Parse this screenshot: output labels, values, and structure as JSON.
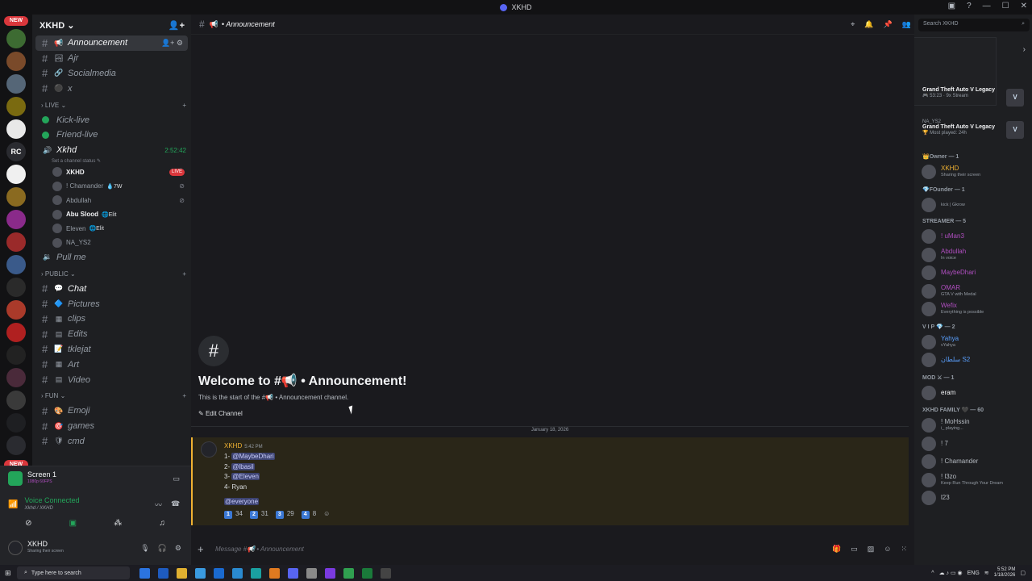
{
  "window": {
    "title": "XKHD"
  },
  "server": {
    "name": "XKHD"
  },
  "guilds": {
    "new_top": "NEW",
    "new_bottom": "NEW",
    "icons": [
      {
        "badge": "",
        "label": "",
        "color": "#3d6b32"
      },
      {
        "badge": "44",
        "label": "",
        "color": "#7a4a2a"
      },
      {
        "badge": "559",
        "label": "",
        "color": "#556677"
      },
      {
        "badge": "74",
        "label": "",
        "color": "#7a6a10"
      },
      {
        "badge": "",
        "label": "",
        "color": "#e8e8e8"
      },
      {
        "badge": "",
        "label": "RC",
        "color": "#2a2b30"
      },
      {
        "badge": "193",
        "label": "",
        "color": "#f0f0f0"
      },
      {
        "badge": "",
        "label": "",
        "color": "#8a6a20"
      },
      {
        "badge": "4K+",
        "label": "",
        "color": "#8a2a8a"
      },
      {
        "badge": "75",
        "label": "",
        "color": "#9a2a2a"
      },
      {
        "badge": "71",
        "label": "",
        "color": "#3a5a8a"
      },
      {
        "badge": "708",
        "label": "",
        "color": "#2a2a2a"
      },
      {
        "badge": "2K+",
        "label": "",
        "color": "#aa3a2a"
      },
      {
        "badge": "",
        "label": "",
        "color": "#b02020"
      },
      {
        "badge": "",
        "label": "",
        "color": "#222222"
      },
      {
        "badge": "",
        "label": "",
        "color": "#4a2a3a"
      },
      {
        "badge": "",
        "label": "",
        "color": "#3a3a3a"
      },
      {
        "badge": "",
        "label": "",
        "color": "#1e1f22"
      },
      {
        "badge": "",
        "label": "",
        "color": "#2a2b30"
      }
    ]
  },
  "channels": {
    "top": [
      {
        "name": "Announcement",
        "emoji": "📢",
        "active": true
      },
      {
        "name": "Ajr",
        "emoji": "🏞"
      },
      {
        "name": "Socialmedia",
        "emoji": "🔗"
      },
      {
        "name": "x",
        "emoji": "⚫"
      }
    ],
    "live_category": "LIVE",
    "live": [
      {
        "name": "Kick-live"
      },
      {
        "name": "Friend-live"
      }
    ],
    "voice_channel": {
      "name": "Xkhd",
      "timer": "2:52:42",
      "status": "Set a channel status"
    },
    "voice_users": [
      {
        "name": "XKHD",
        "tag": "",
        "live": "LIVE",
        "bold": true
      },
      {
        "name": "! Chamander",
        "tag": "💧7W"
      },
      {
        "name": "Abdullah",
        "tag": ""
      },
      {
        "name": "Abu Slood",
        "tag": "🌐Elit",
        "bold": true
      },
      {
        "name": "Eleven",
        "tag": "🌐Elit"
      },
      {
        "name": "NA_YS2",
        "tag": ""
      }
    ],
    "pull_me": "Pull me",
    "public_category": "PUBLIC",
    "public": [
      {
        "name": "Chat",
        "emoji": "💬",
        "bright": true
      },
      {
        "name": "Pictures",
        "emoji": "🔷"
      },
      {
        "name": "clips",
        "emoji": "▦"
      },
      {
        "name": "Edits",
        "emoji": "▤"
      },
      {
        "name": "tklejat",
        "emoji": "📝"
      },
      {
        "name": "Art",
        "emoji": "▦"
      },
      {
        "name": "Video",
        "emoji": "▤"
      }
    ],
    "fun_category": "FUN",
    "fun": [
      {
        "name": "Emoji",
        "emoji": "🎨"
      },
      {
        "name": "games",
        "emoji": "🎯"
      },
      {
        "name": "cmd",
        "emoji": "🛡"
      }
    ]
  },
  "panel": {
    "screen_title": "Screen 1",
    "screen_sub": "1080p 60FPS",
    "voice_connected": "Voice Connected",
    "voice_path": "Xkhd / XKHD",
    "user_name": "XKHD",
    "user_status": "Sharing their screen"
  },
  "chat": {
    "channel_title": "• Announcement",
    "welcome_title": "Welcome to #📢 • Announcement!",
    "welcome_sub": "This is the start of the #📢 • Announcement channel.",
    "edit_channel": "Edit Channel",
    "date": "January 18, 2026",
    "message": {
      "author": "XKHD",
      "time": "5:42 PM",
      "line1_prefix": "1-",
      "line1_mention": "@MaybeDhari",
      "line2_prefix": "2-",
      "line2_mention": "@lbasil",
      "line3_prefix": "3-",
      "line3_mention": "@Eleven",
      "line4": "4- Ryan",
      "everyone": "@everyone",
      "reactions": [
        {
          "key": "1",
          "count": "34"
        },
        {
          "key": "2",
          "count": "31"
        },
        {
          "key": "3",
          "count": "29"
        },
        {
          "key": "4",
          "count": "8"
        }
      ]
    },
    "input_placeholder": "Message #📢 • Announcement"
  },
  "members": {
    "search_placeholder": "Search XKHD",
    "games": [
      {
        "title": "Grand Theft Auto V Legacy",
        "sub": "🎮 53:23 · 9x Stream",
        "user": ""
      },
      {
        "title": "Grand Theft Auto V Legacy",
        "sub": "🏆 Most played: 24h",
        "user": "NA_YS2"
      }
    ],
    "groups": [
      {
        "title": "👑Owner — 1",
        "members": [
          {
            "name": "XKHD",
            "status": "Sharing their screen",
            "color": "#f0b232"
          }
        ]
      },
      {
        "title": "💎FOunder — 1",
        "members": [
          {
            "name": "",
            "status": "kick | Gkrow",
            "color": "#dbdee1"
          }
        ]
      },
      {
        "title": "STREAMER — 5",
        "members": [
          {
            "name": "! uMan3",
            "status": "",
            "color": "#b04ec0"
          },
          {
            "name": "Abdullah",
            "status": "In voice",
            "color": "#b04ec0"
          },
          {
            "name": "MaybeDhari",
            "status": "",
            "color": "#b04ec0"
          },
          {
            "name": "OMAR",
            "status": "GTA V with Medal",
            "color": "#b04ec0"
          },
          {
            "name": "Wefix",
            "status": "Everything is possible",
            "color": "#b04ec0"
          }
        ]
      },
      {
        "title": "V I P 💎 — 2",
        "members": [
          {
            "name": "Yahya",
            "status": "vYahya",
            "color": "#5aa0ff"
          },
          {
            "name": "سلطان S2",
            "status": "",
            "color": "#5aa0ff"
          }
        ]
      },
      {
        "title": "MOD ⚔ — 1",
        "members": [
          {
            "name": "eram",
            "status": "",
            "color": "#f2f3f5"
          }
        ]
      },
      {
        "title": "XKHD FAMILY 🖤 — 60",
        "members": [
          {
            "name": "! MoHssin",
            "status": "i_ playing...",
            "color": "#b5bac1"
          },
          {
            "name": "! 7",
            "status": "",
            "color": "#b5bac1"
          },
          {
            "name": "! Chamander",
            "status": "",
            "color": "#b5bac1"
          },
          {
            "name": "! l3zo",
            "status": "Keep Run Through Your Dream",
            "color": "#b5bac1"
          },
          {
            "name": "l23",
            "status": "",
            "color": "#b5bac1"
          }
        ]
      }
    ]
  },
  "taskbar": {
    "search": "Type here to search",
    "lang": "ENG",
    "time": "5:52 PM",
    "date": "1/18/2026"
  }
}
